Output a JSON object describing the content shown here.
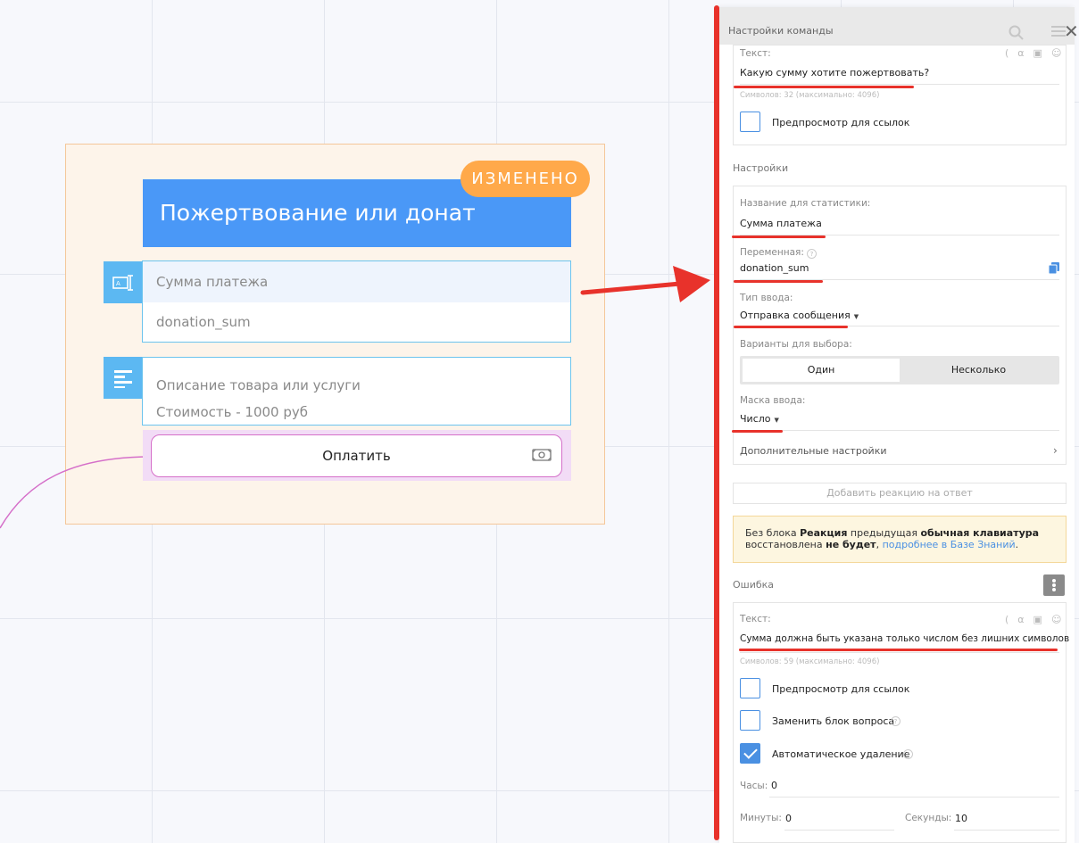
{
  "canvas": {
    "block_title": "Пожертвование или донат",
    "badge": "ИЗМЕНЕНО",
    "input_card": {
      "title": "Сумма платежа",
      "variable": "donation_sum"
    },
    "text_card": {
      "line1": "Описание товара или услуги",
      "line2": "Стоимость - 1000 руб"
    },
    "pay_button": "Оплатить"
  },
  "panel": {
    "title": "Настройки команды",
    "message": {
      "label": "Текст:",
      "value": "Какую сумму хотите пожертвовать?",
      "counter": "Символов: 32 (максимально: 4096)",
      "link_preview": "Предпросмотр для ссылок"
    },
    "settings_title": "Настройки",
    "stat_name": {
      "label": "Название для статистики:",
      "value": "Сумма платежа"
    },
    "variable": {
      "label": "Переменная:",
      "value": "donation_sum"
    },
    "input_type": {
      "label": "Тип ввода:",
      "value": "Отправка сообщения"
    },
    "choice": {
      "label": "Варианты для выбора:",
      "options": [
        "Один",
        "Несколько"
      ],
      "selected": "Один"
    },
    "input_mask": {
      "label": "Маска ввода:",
      "value": "Число"
    },
    "advanced": "Дополнительные настройки",
    "add_reaction": "Добавить реакцию на ответ",
    "notice": {
      "p1": "Без блока ",
      "b1": "Реакция",
      "p2": " предыдущая ",
      "b2": "обычная клавиатура",
      "p3": "восстановлена ",
      "b3": "не будет",
      "p4": ", ",
      "link": "подробнее в Базе Знаний",
      "p5": "."
    },
    "error": {
      "title": "Ошибка",
      "label": "Текст:",
      "value": "Сумма должна быть указана только числом без лишних символов",
      "counter": "Символов: 59 (максимально: 4096)",
      "link_preview": "Предпросмотр для ссылок",
      "replace_question": "Заменить блок вопроса",
      "auto_delete": "Автоматическое удаление",
      "hours_label": "Часы:",
      "hours_value": "0",
      "minutes_label": "Минуты:",
      "minutes_value": "0",
      "seconds_label": "Секунды:",
      "seconds_value": "10"
    },
    "checkboxes": {
      "link_preview_1": false,
      "link_preview_2": false,
      "replace_question": false,
      "auto_delete": true
    }
  },
  "colors": {
    "header_blue": "#4a98f7",
    "badge_orange": "#ffa94a",
    "annotation_red": "#e8322b",
    "accent_blue": "#4a90e2"
  }
}
